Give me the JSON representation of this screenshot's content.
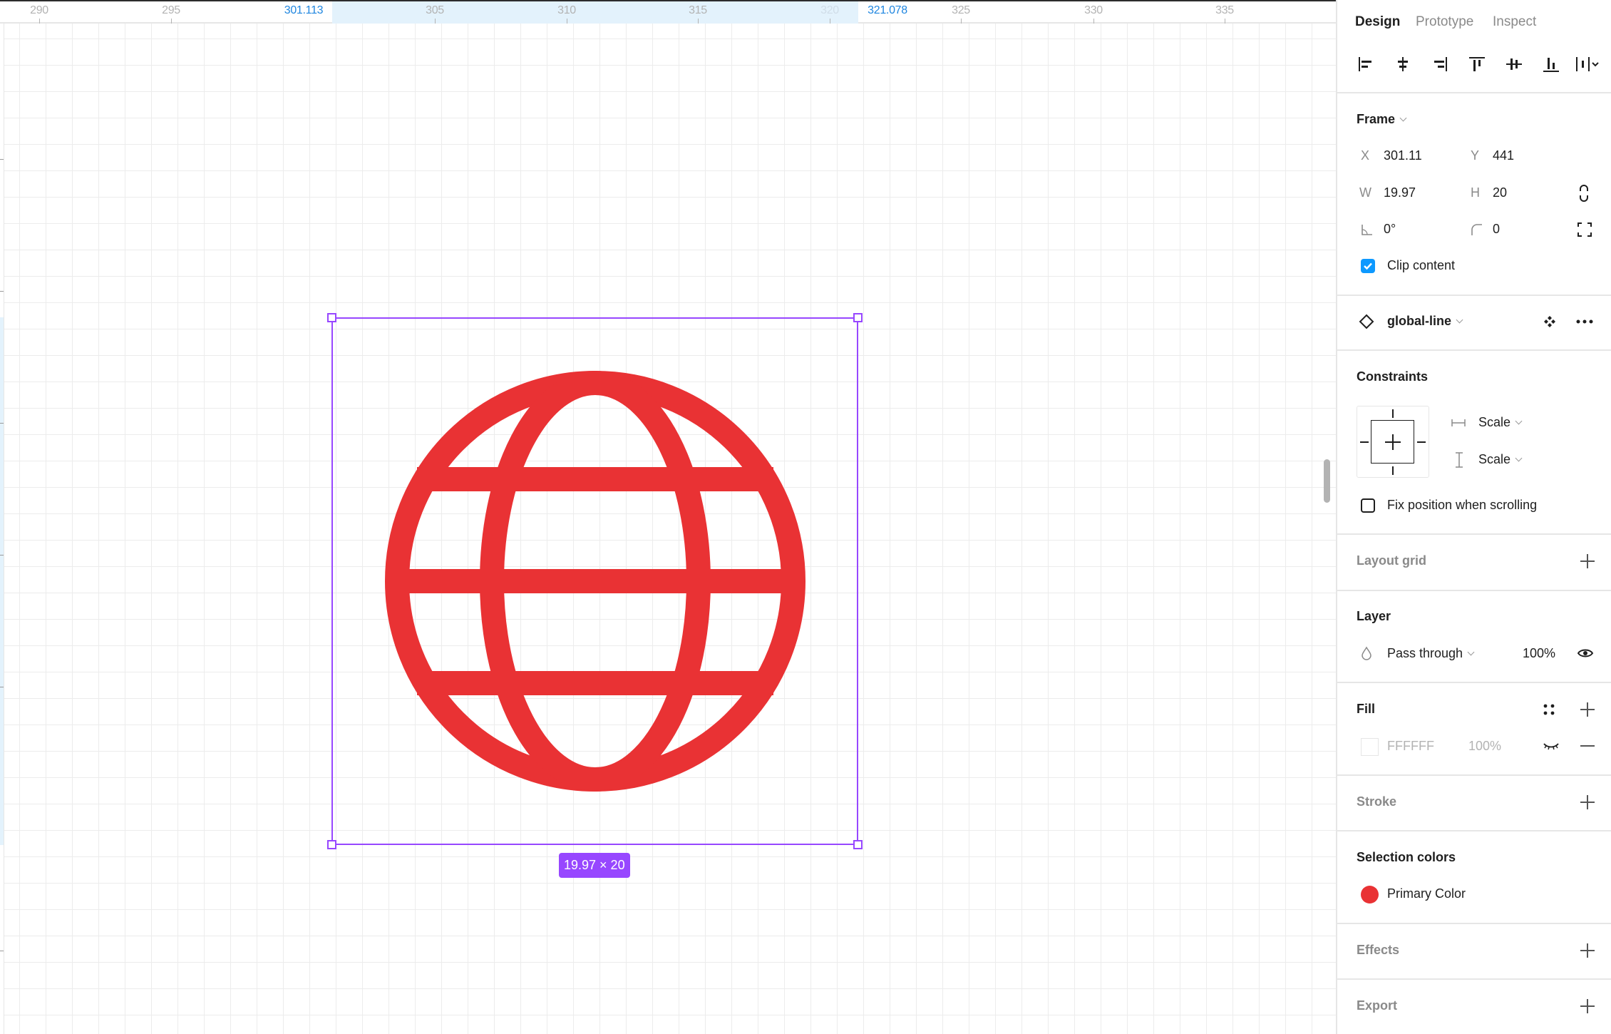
{
  "ruler": {
    "labels": [
      {
        "text": "290",
        "kind": "normal"
      },
      {
        "text": "295",
        "kind": "normal"
      },
      {
        "text": "301.113",
        "kind": "selected"
      },
      {
        "text": "305",
        "kind": "normal"
      },
      {
        "text": "310",
        "kind": "normal"
      },
      {
        "text": "315",
        "kind": "normal"
      },
      {
        "text": "320",
        "kind": "faint"
      },
      {
        "text": "321.078",
        "kind": "selected"
      },
      {
        "text": "325",
        "kind": "normal"
      },
      {
        "text": "330",
        "kind": "normal"
      },
      {
        "text": "335",
        "kind": "normal"
      }
    ]
  },
  "canvas": {
    "selection_size_label": "19.97 × 20",
    "icon_name": "global-line",
    "icon_color": "#e93234",
    "selection_color": "#9747ff"
  },
  "panel": {
    "tabs": [
      {
        "label": "Design",
        "active": true
      },
      {
        "label": "Prototype",
        "active": false
      },
      {
        "label": "Inspect",
        "active": false
      }
    ],
    "align_tools": [
      "align-left",
      "align-horizontal-center",
      "align-right",
      "align-top",
      "align-vertical-center",
      "align-bottom",
      "distribute-spacing"
    ],
    "frame": {
      "title": "Frame",
      "x_label": "X",
      "x_value": "301.11",
      "y_label": "Y",
      "y_value": "441",
      "w_label": "W",
      "w_value": "19.97",
      "h_label": "H",
      "h_value": "20",
      "rotation_value": "0°",
      "radius_value": "0",
      "clip_content_label": "Clip content",
      "clip_content_checked": true
    },
    "component": {
      "name": "global-line"
    },
    "constraints": {
      "title": "Constraints",
      "horizontal": "Scale",
      "vertical": "Scale",
      "fix_position_label": "Fix position when scrolling",
      "fix_position_checked": false
    },
    "layout_grid": {
      "title": "Layout grid"
    },
    "layer": {
      "title": "Layer",
      "blend_mode": "Pass through",
      "opacity": "100%"
    },
    "fill": {
      "title": "Fill",
      "hex": "FFFFFF",
      "opacity": "100%",
      "swatch_color": "#ffffff"
    },
    "stroke": {
      "title": "Stroke"
    },
    "selection_colors": {
      "title": "Selection colors",
      "items": [
        {
          "label": "Primary Color",
          "color": "#e93234"
        }
      ]
    },
    "effects": {
      "title": "Effects"
    },
    "export": {
      "title": "Export"
    }
  }
}
